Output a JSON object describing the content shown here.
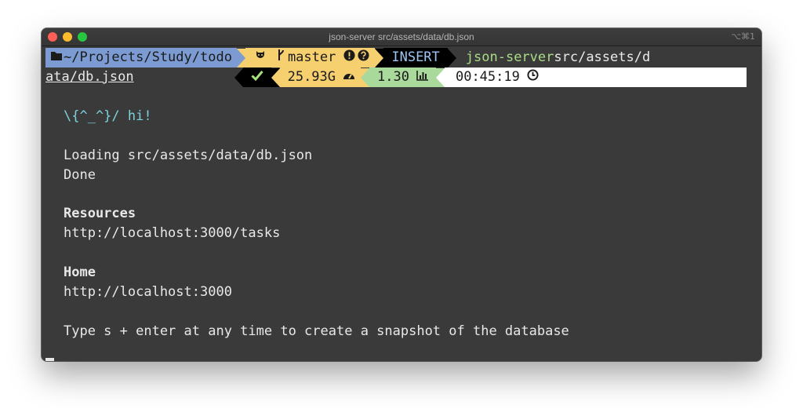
{
  "window": {
    "title": "json-server src/assets/data/db.json",
    "shortcut": "⌥⌘1"
  },
  "prompt": {
    "dir_icon": "folder-icon",
    "dir": "~/Projects/Study/todo",
    "git_icon": "github-octocat-icon",
    "branch_icon": "git-branch-icon",
    "branch": "master",
    "status_icons": [
      "alert-circle-icon",
      "question-circle-icon"
    ],
    "mode": "INSERT",
    "command": "json-server",
    "argument_line1": " src/assets/d",
    "argument_line2": "ata/db.json",
    "ok_icon": "checkmark-icon",
    "memory": "25.93G",
    "memory_icon": "dashboard-icon",
    "load": "1.30",
    "load_icon": "bar-chart-icon",
    "time": "00:45:19",
    "time_icon": "clock-icon"
  },
  "output": {
    "greeting": "\\{^_^}/ hi!",
    "loading": "Loading src/assets/data/db.json",
    "done": "Done",
    "resources_heading": "Resources",
    "resources_url": "http://localhost:3000/tasks",
    "home_heading": "Home",
    "home_url": "http://localhost:3000",
    "hint": "Type s + enter at any time to create a snapshot of the database"
  },
  "colors": {
    "dir_segment": "#7b9bd2",
    "git_segment": "#f6cf6f",
    "mode_segment": "#000000",
    "mode_text": "#9ec5f2",
    "command_text": "#a9dd87",
    "greeting_text": "#7dd2dc",
    "load_segment": "#a9d99b",
    "time_segment": "#ffffff",
    "terminal_bg": "#3a3a3a"
  }
}
